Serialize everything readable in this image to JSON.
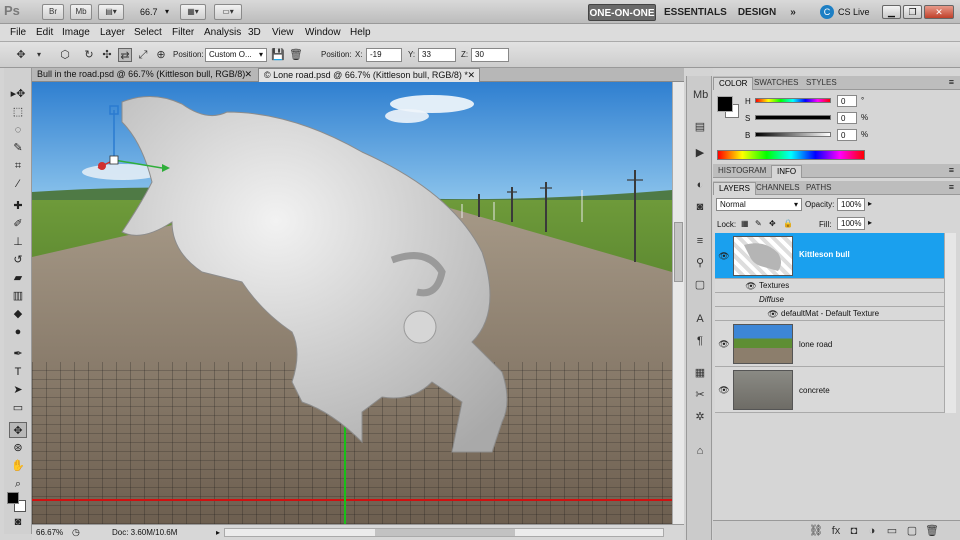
{
  "appbar": {
    "logo": "Ps",
    "bridge": "Br",
    "minibridge": "Mb",
    "zoom": "66.7",
    "workspaces": [
      "ONE-ON-ONE",
      "ESSENTIALS",
      "DESIGN"
    ],
    "more": "»",
    "cslive": "CS Live"
  },
  "menu": [
    "File",
    "Edit",
    "Image",
    "Layer",
    "Select",
    "Filter",
    "Analysis",
    "3D",
    "View",
    "Window",
    "Help"
  ],
  "options": {
    "position_label": "Position:",
    "position_value": "Custom O...",
    "position_label2": "Position:",
    "x_label": "X:",
    "x_value": "-19",
    "y_label": "Y:",
    "y_value": "33",
    "z_label": "Z:",
    "z_value": "30"
  },
  "tabs": [
    {
      "label": "Bull in the road.psd @ 66.7% (Kittleson bull, RGB/8)"
    },
    {
      "label": "© Lone road.psd @ 66.7% (Kittleson bull, RGB/8) *"
    }
  ],
  "status": {
    "zoom": "66.67%",
    "doc": "Doc: 3.60M/10.6M"
  },
  "color_panel": {
    "tabs": [
      "COLOR",
      "SWATCHES",
      "STYLES"
    ],
    "h_label": "H",
    "h_value": "0",
    "h_unit": "°",
    "s_label": "S",
    "s_value": "0",
    "s_unit": "%",
    "b_label": "B",
    "b_value": "0",
    "b_unit": "%"
  },
  "histogram_tabs": [
    "HISTOGRAM",
    "INFO"
  ],
  "layers_panel": {
    "tabs": [
      "LAYERS",
      "CHANNELS",
      "PATHS"
    ],
    "blend_mode": "Normal",
    "opacity_label": "Opacity:",
    "opacity_value": "100%",
    "lock_label": "Lock:",
    "fill_label": "Fill:",
    "fill_value": "100%",
    "layers": [
      {
        "name": "Kittleson bull",
        "selected": true
      },
      {
        "name": "lone road",
        "selected": false
      },
      {
        "name": "concrete",
        "selected": false
      }
    ],
    "sub_textures": "Textures",
    "sub_diffuse": "Diffuse",
    "sub_material": "defaultMat - Default Texture"
  },
  "colors": {
    "accent": "#1aa7f0",
    "selected_layer": "#1aa0ee",
    "grid_red": "#d01010",
    "grid_green": "#18c018"
  }
}
